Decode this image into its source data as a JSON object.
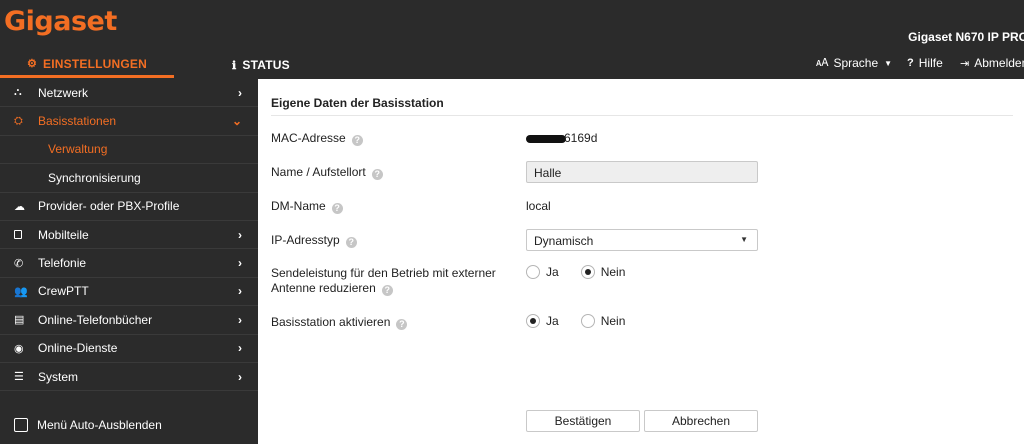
{
  "header": {
    "logo": "Gigaset",
    "product": "Gigaset N670 IP PRO",
    "tabs": [
      {
        "label": "EINSTELLUNGEN",
        "icon": "cogs-icon"
      },
      {
        "label": "STATUS",
        "icon": "info-icon"
      }
    ],
    "actions": {
      "language": "Sprache",
      "help": "Hilfe",
      "logout": "Abmelden"
    }
  },
  "sidebar": {
    "items": [
      {
        "label": "Netzwerk",
        "icon": "network-icon"
      },
      {
        "label": "Basisstationen",
        "icon": "basestations-icon"
      },
      {
        "label": "Verwaltung"
      },
      {
        "label": "Synchronisierung"
      },
      {
        "label": "Provider- oder PBX-Profile",
        "icon": "cloud-icon"
      },
      {
        "label": "Mobilteile",
        "icon": "handset-icon"
      },
      {
        "label": "Telefonie",
        "icon": "phone-icon"
      },
      {
        "label": "CrewPTT",
        "icon": "group-icon"
      },
      {
        "label": "Online-Telefonbücher",
        "icon": "book-icon"
      },
      {
        "label": "Online-Dienste",
        "icon": "globe-icon"
      },
      {
        "label": "System",
        "icon": "sliders-icon"
      }
    ],
    "autohide_label": "Menü Auto-Ausblenden"
  },
  "form": {
    "title": "Eigene Daten der Basisstation",
    "mac_label": "MAC-Adresse",
    "mac_value": "6169d",
    "name_label": "Name / Aufstellort",
    "name_value": "Halle",
    "dm_label": "DM-Name",
    "dm_value": "local",
    "ip_label": "IP-Adresstyp",
    "ip_value": "Dynamisch",
    "tx_label_line1": "Sendeleistung für den Betrieb mit externer",
    "tx_label_line2": "Antenne reduzieren",
    "activate_label": "Basisstation aktivieren",
    "yes": "Ja",
    "no": "Nein",
    "tx_selected": "Nein",
    "activate_selected": "Ja"
  },
  "buttons": {
    "confirm": "Bestätigen",
    "cancel": "Abbrechen"
  },
  "colors": {
    "accent": "#f36e23",
    "dark": "#2b2b2b"
  }
}
